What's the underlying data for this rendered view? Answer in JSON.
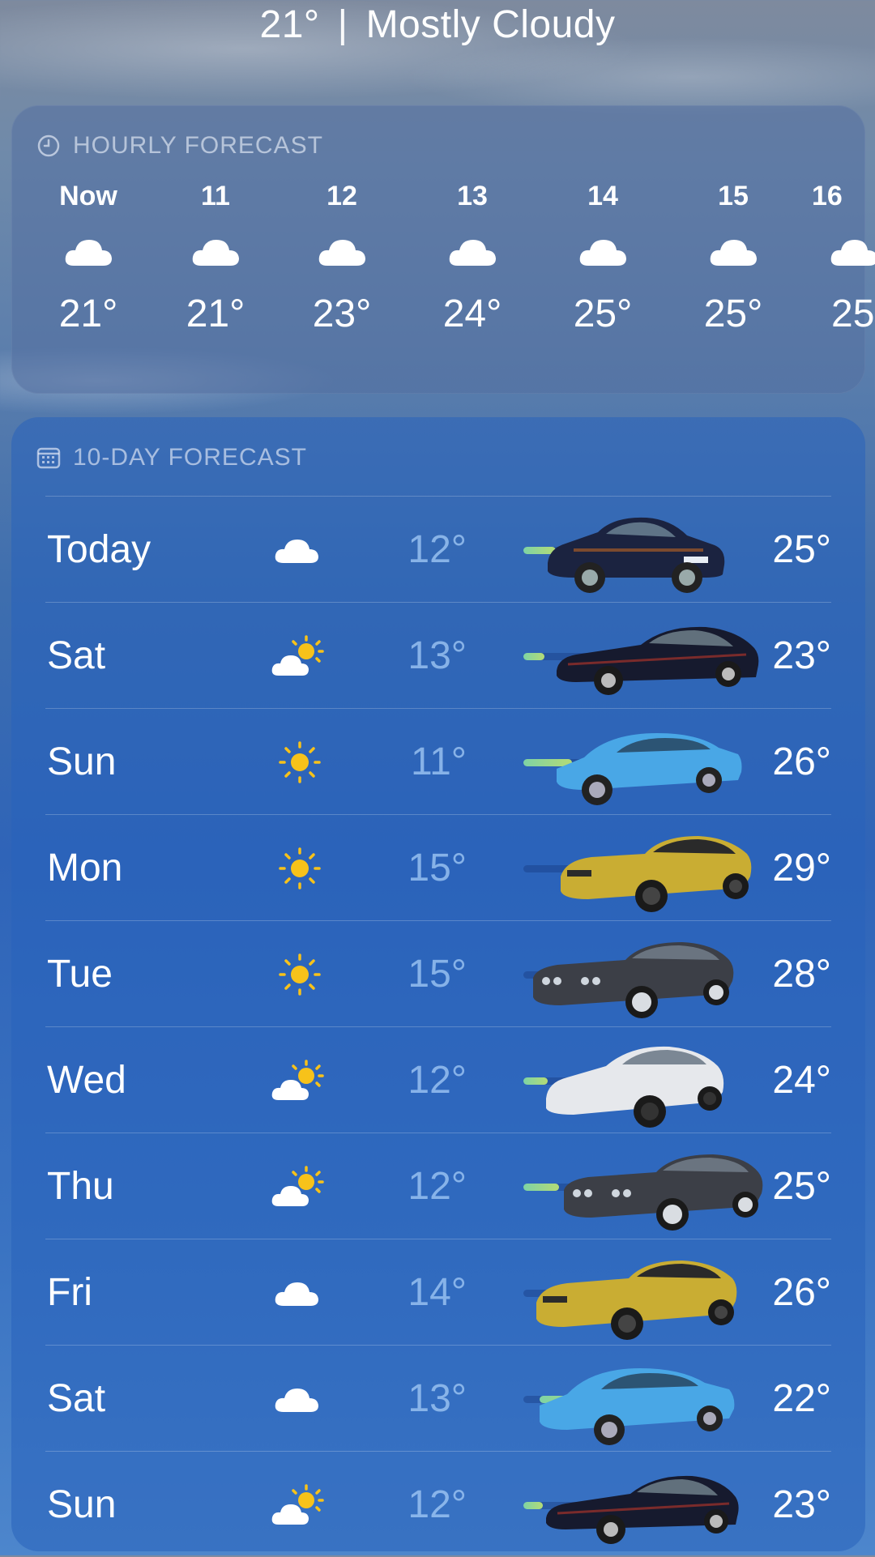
{
  "current": {
    "temp": "21°",
    "separator": "|",
    "condition": "Mostly Cloudy"
  },
  "hourly": {
    "header": "HOURLY FORECAST",
    "header_icon": "clock-icon",
    "items": [
      {
        "time": "Now",
        "icon": "cloud-icon",
        "temp": "21°"
      },
      {
        "time": "11",
        "icon": "cloud-icon",
        "temp": "21°"
      },
      {
        "time": "12",
        "icon": "cloud-icon",
        "temp": "23°"
      },
      {
        "time": "13",
        "icon": "cloud-icon",
        "temp": "24°"
      },
      {
        "time": "14",
        "icon": "cloud-icon",
        "temp": "25°"
      },
      {
        "time": "15",
        "icon": "cloud-icon",
        "temp": "25°"
      },
      {
        "time": "16",
        "icon": "cloud-icon",
        "temp": "25"
      }
    ]
  },
  "daily": {
    "header": "10-DAY FORECAST",
    "header_icon": "calendar-icon",
    "days": [
      {
        "day": "Today",
        "icon": "cloud-icon",
        "low": "12°",
        "high": "25°",
        "car": "dark-blue-hatchback"
      },
      {
        "day": "Sat",
        "icon": "partly-sunny-icon",
        "low": "13°",
        "high": "23°",
        "car": "navy-coupe"
      },
      {
        "day": "Sun",
        "icon": "sun-icon",
        "low": "11°",
        "high": "26°",
        "car": "light-blue-saloon"
      },
      {
        "day": "Mon",
        "icon": "sun-icon",
        "low": "15°",
        "high": "29°",
        "car": "yellow-convertible"
      },
      {
        "day": "Tue",
        "icon": "sun-icon",
        "low": "15°",
        "high": "28°",
        "car": "grey-convertible"
      },
      {
        "day": "Wed",
        "icon": "partly-sunny-icon",
        "low": "12°",
        "high": "24°",
        "car": "white-sports-hatch"
      },
      {
        "day": "Thu",
        "icon": "partly-sunny-icon",
        "low": "12°",
        "high": "25°",
        "car": "grey-convertible"
      },
      {
        "day": "Fri",
        "icon": "cloud-icon",
        "low": "14°",
        "high": "26°",
        "car": "yellow-convertible"
      },
      {
        "day": "Sat",
        "icon": "cloud-icon",
        "low": "13°",
        "high": "22°",
        "car": "light-blue-saloon"
      },
      {
        "day": "Sun",
        "icon": "partly-sunny-icon",
        "low": "12°",
        "high": "23°",
        "car": "navy-coupe"
      }
    ],
    "colors": {
      "bar_start": "#7ed3a5",
      "bar_end": "#b4db76",
      "low_temp": "#a0c8f5"
    }
  }
}
